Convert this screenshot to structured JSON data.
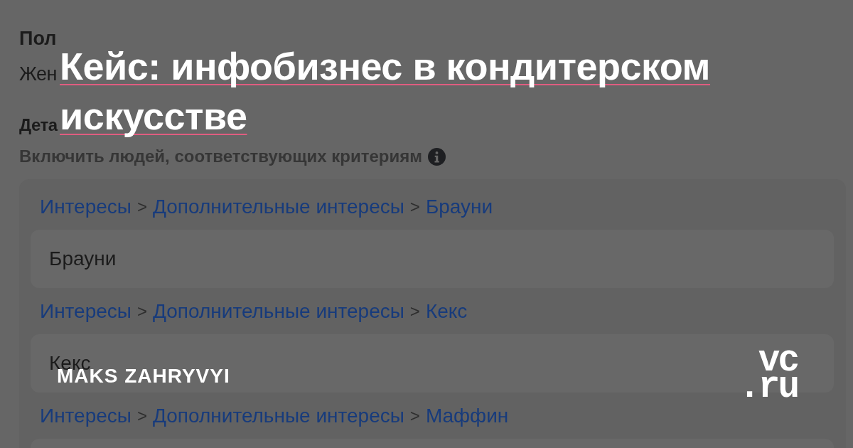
{
  "screenshot": {
    "gender": {
      "label": "Пол",
      "value": "Жен"
    },
    "targeting": {
      "label": "Дета",
      "hint": "Включить людей, соответствующих критериям"
    },
    "interests": [
      {
        "crumbs": [
          {
            "kind": "link",
            "text": "Интересы"
          },
          {
            "kind": "separator",
            "text": ">"
          },
          {
            "kind": "link",
            "text": "Дополнительные интересы"
          },
          {
            "kind": "separator",
            "text": ">"
          },
          {
            "kind": "link",
            "text": "Брауни"
          }
        ],
        "value": "Брауни"
      },
      {
        "crumbs": [
          {
            "kind": "link",
            "text": "Интересы"
          },
          {
            "kind": "separator",
            "text": ">"
          },
          {
            "kind": "link",
            "text": "Дополнительные интересы"
          },
          {
            "kind": "separator",
            "text": ">"
          },
          {
            "kind": "link",
            "text": "Кекс"
          }
        ],
        "value": "Кекс"
      },
      {
        "crumbs": [
          {
            "kind": "link",
            "text": "Интересы"
          },
          {
            "kind": "separator",
            "text": ">"
          },
          {
            "kind": "link",
            "text": "Дополнительные интересы"
          },
          {
            "kind": "separator",
            "text": ">"
          },
          {
            "kind": "link",
            "text": "Маффин"
          }
        ]
      }
    ]
  },
  "article": {
    "title": "Кейс: инфобизнес в кондитерском искусстве",
    "author": "MAKS ZAHRYVYI"
  },
  "logo": [
    "vc",
    ".ru"
  ]
}
